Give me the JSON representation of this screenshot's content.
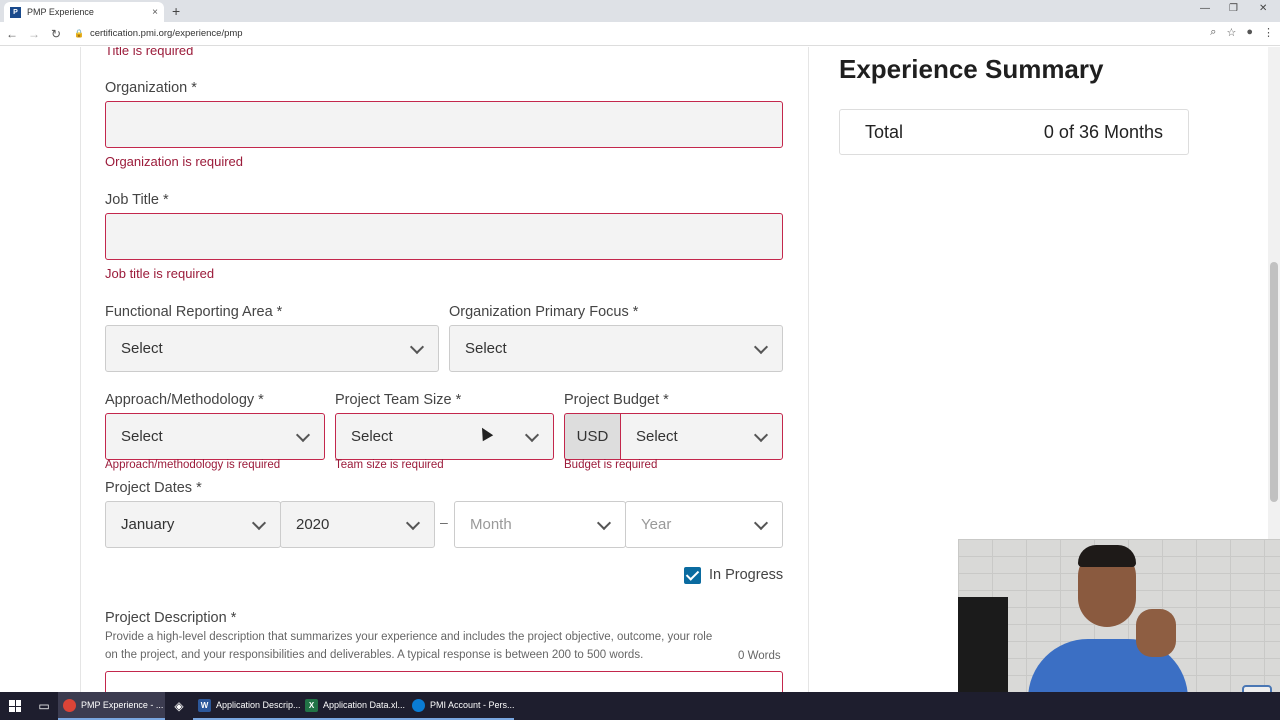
{
  "browser": {
    "tab_title": "PMP Experience",
    "tab_close": "×",
    "new_tab": "+",
    "url": "certification.pmi.org/experience/pmp",
    "window_controls": [
      "—",
      "❐",
      "✕"
    ]
  },
  "form": {
    "top_error": "Title is required",
    "organization": {
      "label": "Organization *",
      "error": "Organization is required"
    },
    "job_title": {
      "label": "Job Title *",
      "error": "Job title is required"
    },
    "functional_area": {
      "label": "Functional Reporting Area *",
      "value": "Select"
    },
    "org_focus": {
      "label": "Organization Primary Focus *",
      "value": "Select"
    },
    "approach": {
      "label": "Approach/Methodology *",
      "value": "Select",
      "error": "Approach/methodology is required"
    },
    "team_size": {
      "label": "Project Team Size *",
      "value": "Select",
      "error": "Team size is required"
    },
    "budget": {
      "label": "Project Budget *",
      "currency": "USD",
      "value": "Select",
      "error": "Budget is required"
    },
    "dates": {
      "label": "Project Dates *",
      "start_month": "January",
      "start_year": "2020",
      "separator": "–",
      "end_month_placeholder": "Month",
      "end_year_placeholder": "Year"
    },
    "in_progress": {
      "label": "In Progress",
      "checked": true
    },
    "description": {
      "label": "Project Description *",
      "help": "Provide a high-level description that summarizes your experience and includes the project objective, outcome, your role on the project, and your responsibilities and deliverables. A typical response is between 200 to 500 words.",
      "word_count": "0 Words"
    }
  },
  "summary": {
    "title": "Experience Summary",
    "total_label": "Total",
    "total_value": "0 of 36 Months"
  },
  "taskbar": {
    "apps": [
      {
        "label": "PMP Experience - ...",
        "icon": "chrome-icon",
        "color": "#db4437"
      },
      {
        "label": "Application Descrip...",
        "icon": "word-icon",
        "color": "#2b579a"
      },
      {
        "label": "Application Data.xl...",
        "icon": "excel-icon",
        "color": "#217346"
      },
      {
        "label": "PMI Account - Pers...",
        "icon": "edge-icon",
        "color": "#0a7cd4"
      }
    ]
  },
  "colors": {
    "error": "#9b1b3a",
    "checkbox": "#0a6ba0"
  }
}
